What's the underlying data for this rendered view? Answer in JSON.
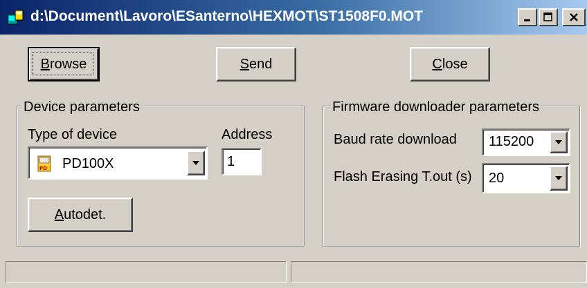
{
  "window": {
    "title": "d:\\Document\\Lavoro\\ESanterno\\HEXMOT\\ST1508F0.MOT"
  },
  "toolbar": {
    "browse_label": "Browse",
    "send_label": "Send",
    "close_label": "Close"
  },
  "device_group": {
    "legend": "Device parameters",
    "type_label": "Type of device",
    "type_value": "PD100X",
    "address_label": "Address",
    "address_value": "1",
    "autodet_label": "Autodet."
  },
  "firmware_group": {
    "legend": "Firmware downloader parameters",
    "baud_label": "Baud rate download",
    "baud_value": "115200",
    "flash_label": "Flash Erasing T.out (s)",
    "flash_value": "20"
  },
  "colors": {
    "face": "#d4d0c8",
    "title_start": "#0a246a",
    "title_end": "#a6caf0"
  },
  "icons": {
    "app": "app-window-icon",
    "device": "pd-device-icon",
    "dropdown": "chevron-down-icon"
  }
}
